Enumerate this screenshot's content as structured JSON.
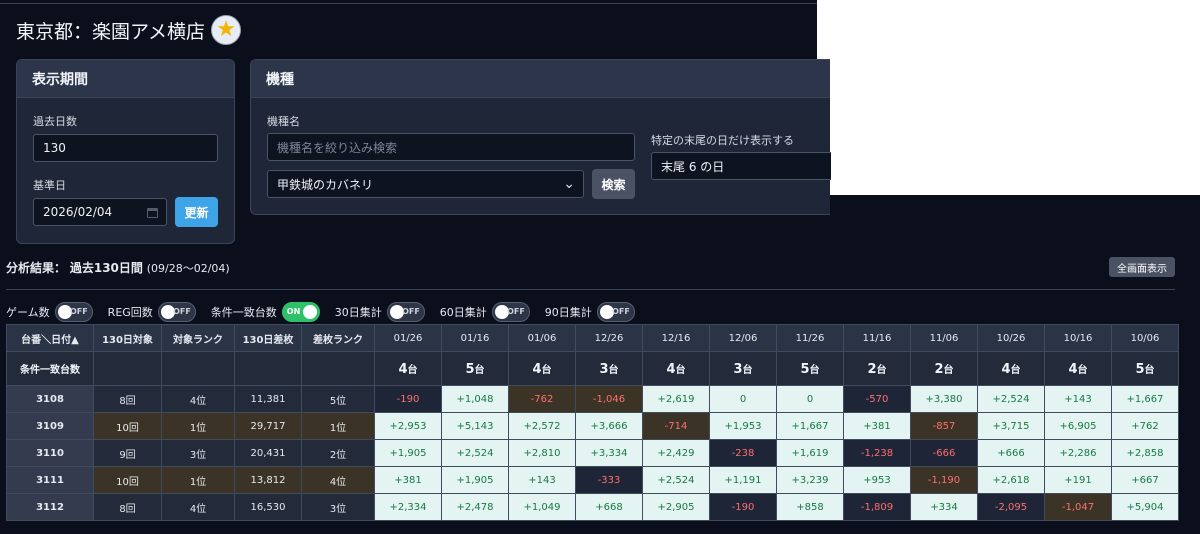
{
  "store": {
    "title": "東京都：楽園アメ横店",
    "favorite_icon": "star-icon"
  },
  "period_panel": {
    "heading": "表示期間",
    "days_label": "過去日数",
    "days_value": "130",
    "base_label": "基準日",
    "base_value": "2026/02/04",
    "update_button": "更新"
  },
  "machine_panel": {
    "heading": "機種",
    "name_label": "機種名",
    "search_placeholder": "機種名を絞り込み検索",
    "selected_machine": "甲鉄城のカバネリ",
    "search_button": "検索",
    "tail_label": "特定の末尾の日だけ表示する",
    "tail_value": "末尾 6 の日"
  },
  "result": {
    "label": "分析結果：",
    "summary": "過去130日間",
    "range": "(09/28〜02/04)",
    "fullscreen_button": "全画面表示"
  },
  "toggles": [
    {
      "label": "ゲーム数",
      "state": "OFF",
      "on": false
    },
    {
      "label": "REG回数",
      "state": "OFF",
      "on": false
    },
    {
      "label": "条件一致台数",
      "state": "ON",
      "on": true
    },
    {
      "label": "30日集計",
      "state": "OFF",
      "on": false
    },
    {
      "label": "60日集計",
      "state": "OFF",
      "on": false
    },
    {
      "label": "90日集計",
      "state": "OFF",
      "on": false
    }
  ],
  "table": {
    "columns": [
      "台番＼日付▲",
      "130日対象",
      "対象ランク",
      "130日差枚",
      "差枚ランク"
    ],
    "dates": [
      "01/26",
      "01/16",
      "01/06",
      "12/26",
      "12/16",
      "12/06",
      "11/26",
      "11/16",
      "11/06",
      "10/26",
      "10/16",
      "10/06"
    ],
    "count_row_label": "条件一致台数",
    "count_unit": "台",
    "counts": [
      "4",
      "5",
      "4",
      "3",
      "4",
      "3",
      "5",
      "2",
      "2",
      "4",
      "4",
      "5"
    ],
    "rows": [
      {
        "machine": "3108",
        "target": "8回",
        "target_rank": "4位",
        "diff": "11,381",
        "diff_rank": "5位",
        "highlight": false,
        "values": [
          "-190",
          "+1,048",
          "-762",
          "-1,046",
          "+2,619",
          "0",
          "0",
          "-570",
          "+3,380",
          "+2,524",
          "+143",
          "+1,667"
        ]
      },
      {
        "machine": "3109",
        "target": "10回",
        "target_rank": "1位",
        "diff": "29,717",
        "diff_rank": "1位",
        "highlight": true,
        "values": [
          "+2,953",
          "+5,143",
          "+2,572",
          "+3,666",
          "-714",
          "+1,953",
          "+1,667",
          "+381",
          "-857",
          "+3,715",
          "+6,905",
          "+762"
        ]
      },
      {
        "machine": "3110",
        "target": "9回",
        "target_rank": "3位",
        "diff": "20,431",
        "diff_rank": "2位",
        "highlight": false,
        "values": [
          "+1,905",
          "+2,524",
          "+2,810",
          "+3,334",
          "+2,429",
          "-238",
          "+1,619",
          "-1,238",
          "-666",
          "+666",
          "+2,286",
          "+2,858"
        ]
      },
      {
        "machine": "3111",
        "target": "10回",
        "target_rank": "1位",
        "diff": "13,812",
        "diff_rank": "4位",
        "highlight": true,
        "values": [
          "+381",
          "+1,905",
          "+143",
          "-333",
          "+2,524",
          "+1,191",
          "+3,239",
          "+953",
          "-1,190",
          "+2,618",
          "+191",
          "+667"
        ]
      },
      {
        "machine": "3112",
        "target": "8回",
        "target_rank": "4位",
        "diff": "16,530",
        "diff_rank": "3位",
        "highlight": false,
        "values": [
          "+2,334",
          "+2,478",
          "+1,049",
          "+668",
          "+2,905",
          "-190",
          "+858",
          "-1,809",
          "+334",
          "-2,095",
          "-1,047",
          "+5,904"
        ]
      }
    ]
  }
}
